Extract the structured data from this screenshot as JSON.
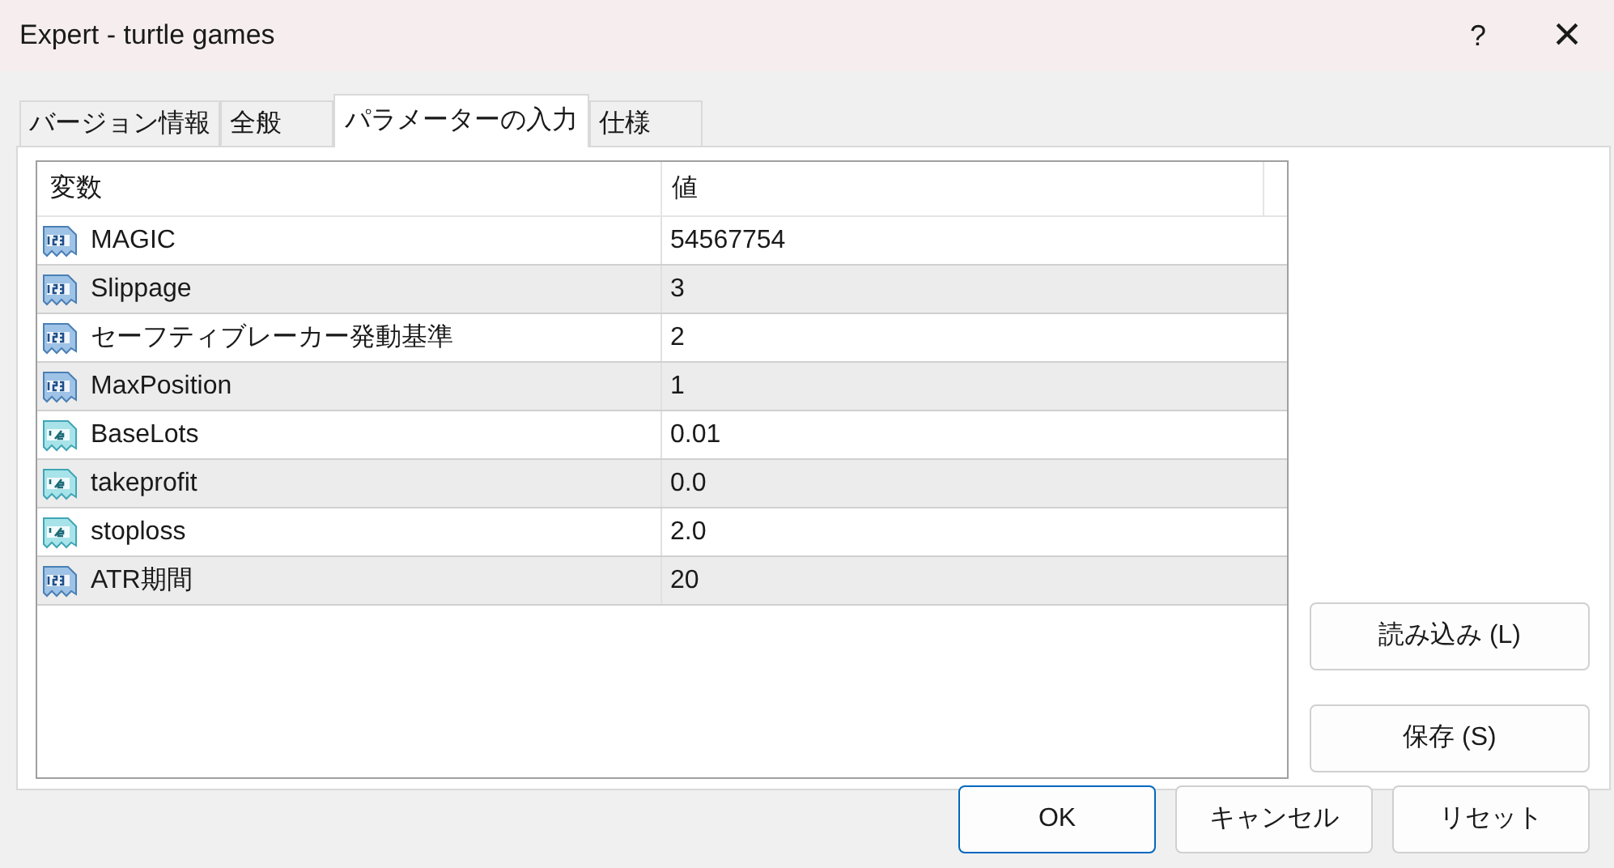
{
  "window": {
    "title": "Expert - turtle games",
    "help": "?",
    "close": "×"
  },
  "tabs": [
    {
      "label": "バージョン情報",
      "selected": false
    },
    {
      "label": "全般",
      "selected": false
    },
    {
      "label": "パラメーターの入力",
      "selected": true
    },
    {
      "label": "仕様",
      "selected": false
    }
  ],
  "table": {
    "columns": [
      "変数",
      "値"
    ],
    "rows": [
      {
        "kind": "int",
        "name": "MAGIC",
        "value": "54567754"
      },
      {
        "kind": "int",
        "name": "Slippage",
        "value": "3"
      },
      {
        "kind": "int",
        "name": "セーフティブレーカー発動基準",
        "value": "2"
      },
      {
        "kind": "int",
        "name": "MaxPosition",
        "value": "1"
      },
      {
        "kind": "double",
        "name": "BaseLots",
        "value": "0.01"
      },
      {
        "kind": "double",
        "name": "takeprofit",
        "value": "0.0"
      },
      {
        "kind": "double",
        "name": "stoploss",
        "value": "2.0"
      },
      {
        "kind": "int",
        "name": "ATR期間",
        "value": "20"
      }
    ]
  },
  "side_buttons": [
    "読み込み (L)",
    "保存 (S)"
  ],
  "buttons": [
    {
      "label": "OK",
      "default": true
    },
    {
      "label": "キャンセル",
      "default": false
    },
    {
      "label": "リセット",
      "default": false
    }
  ]
}
